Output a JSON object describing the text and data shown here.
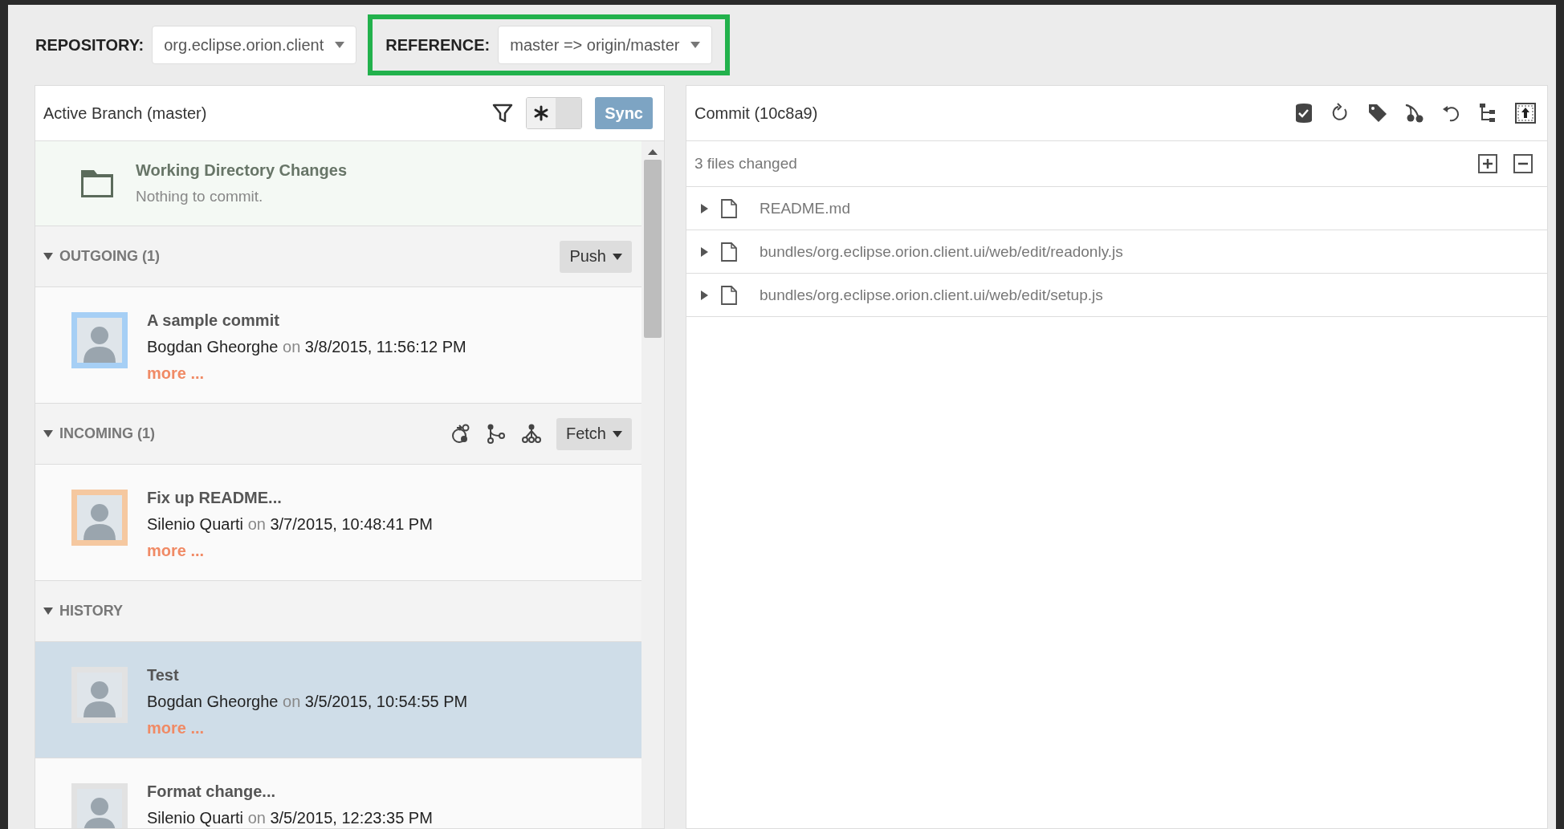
{
  "repository": {
    "label": "REPOSITORY:",
    "value": "org.eclipse.orion.client"
  },
  "reference": {
    "label": "REFERENCE:",
    "value": "master => origin/master",
    "highlighted": true
  },
  "branch_panel": {
    "title": "Active Branch (master)",
    "sync_button": "Sync",
    "toggle_on": true,
    "working_directory": {
      "title": "Working Directory Changes",
      "status": "Nothing to commit."
    },
    "sections": [
      {
        "kind": "outgoing",
        "title": "OUTGOING (1)",
        "expanded": true,
        "button": "Push",
        "commits": [
          {
            "title": "A sample commit",
            "author": "Bogdan Gheorghe",
            "on": "on",
            "date": "3/8/2015, 11:56:12 PM",
            "more": "more ...",
            "color": "#a6cff5",
            "selected": false
          }
        ]
      },
      {
        "kind": "incoming",
        "title": "INCOMING (1)",
        "expanded": true,
        "button": "Fetch",
        "commits": [
          {
            "title": "Fix up README...",
            "author": "Silenio Quarti",
            "on": "on",
            "date": "3/7/2015, 10:48:41 PM",
            "more": "more ...",
            "color": "#f5c8a0",
            "selected": false
          }
        ]
      },
      {
        "kind": "history",
        "title": "HISTORY",
        "expanded": true,
        "commits": [
          {
            "title": "Test",
            "author": "Bogdan Gheorghe",
            "on": "on",
            "date": "3/5/2015, 10:54:55 PM",
            "more": "more ...",
            "color": "#e2e2e2",
            "selected": true
          },
          {
            "title": "Format change...",
            "author": "Silenio Quarti",
            "on": "on",
            "date": "3/5/2015, 12:23:35 PM",
            "color": "#e2e2e2",
            "selected": false
          }
        ]
      }
    ]
  },
  "commit_panel": {
    "title": "Commit (10c8a9)",
    "summary": "3 files changed",
    "files": [
      {
        "name": "README.md",
        "expanded": false
      },
      {
        "name": "bundles/org.eclipse.orion.client.ui/web/edit/readonly.js",
        "expanded": false
      },
      {
        "name": "bundles/org.eclipse.orion.client.ui/web/edit/setup.js",
        "expanded": false
      }
    ]
  }
}
